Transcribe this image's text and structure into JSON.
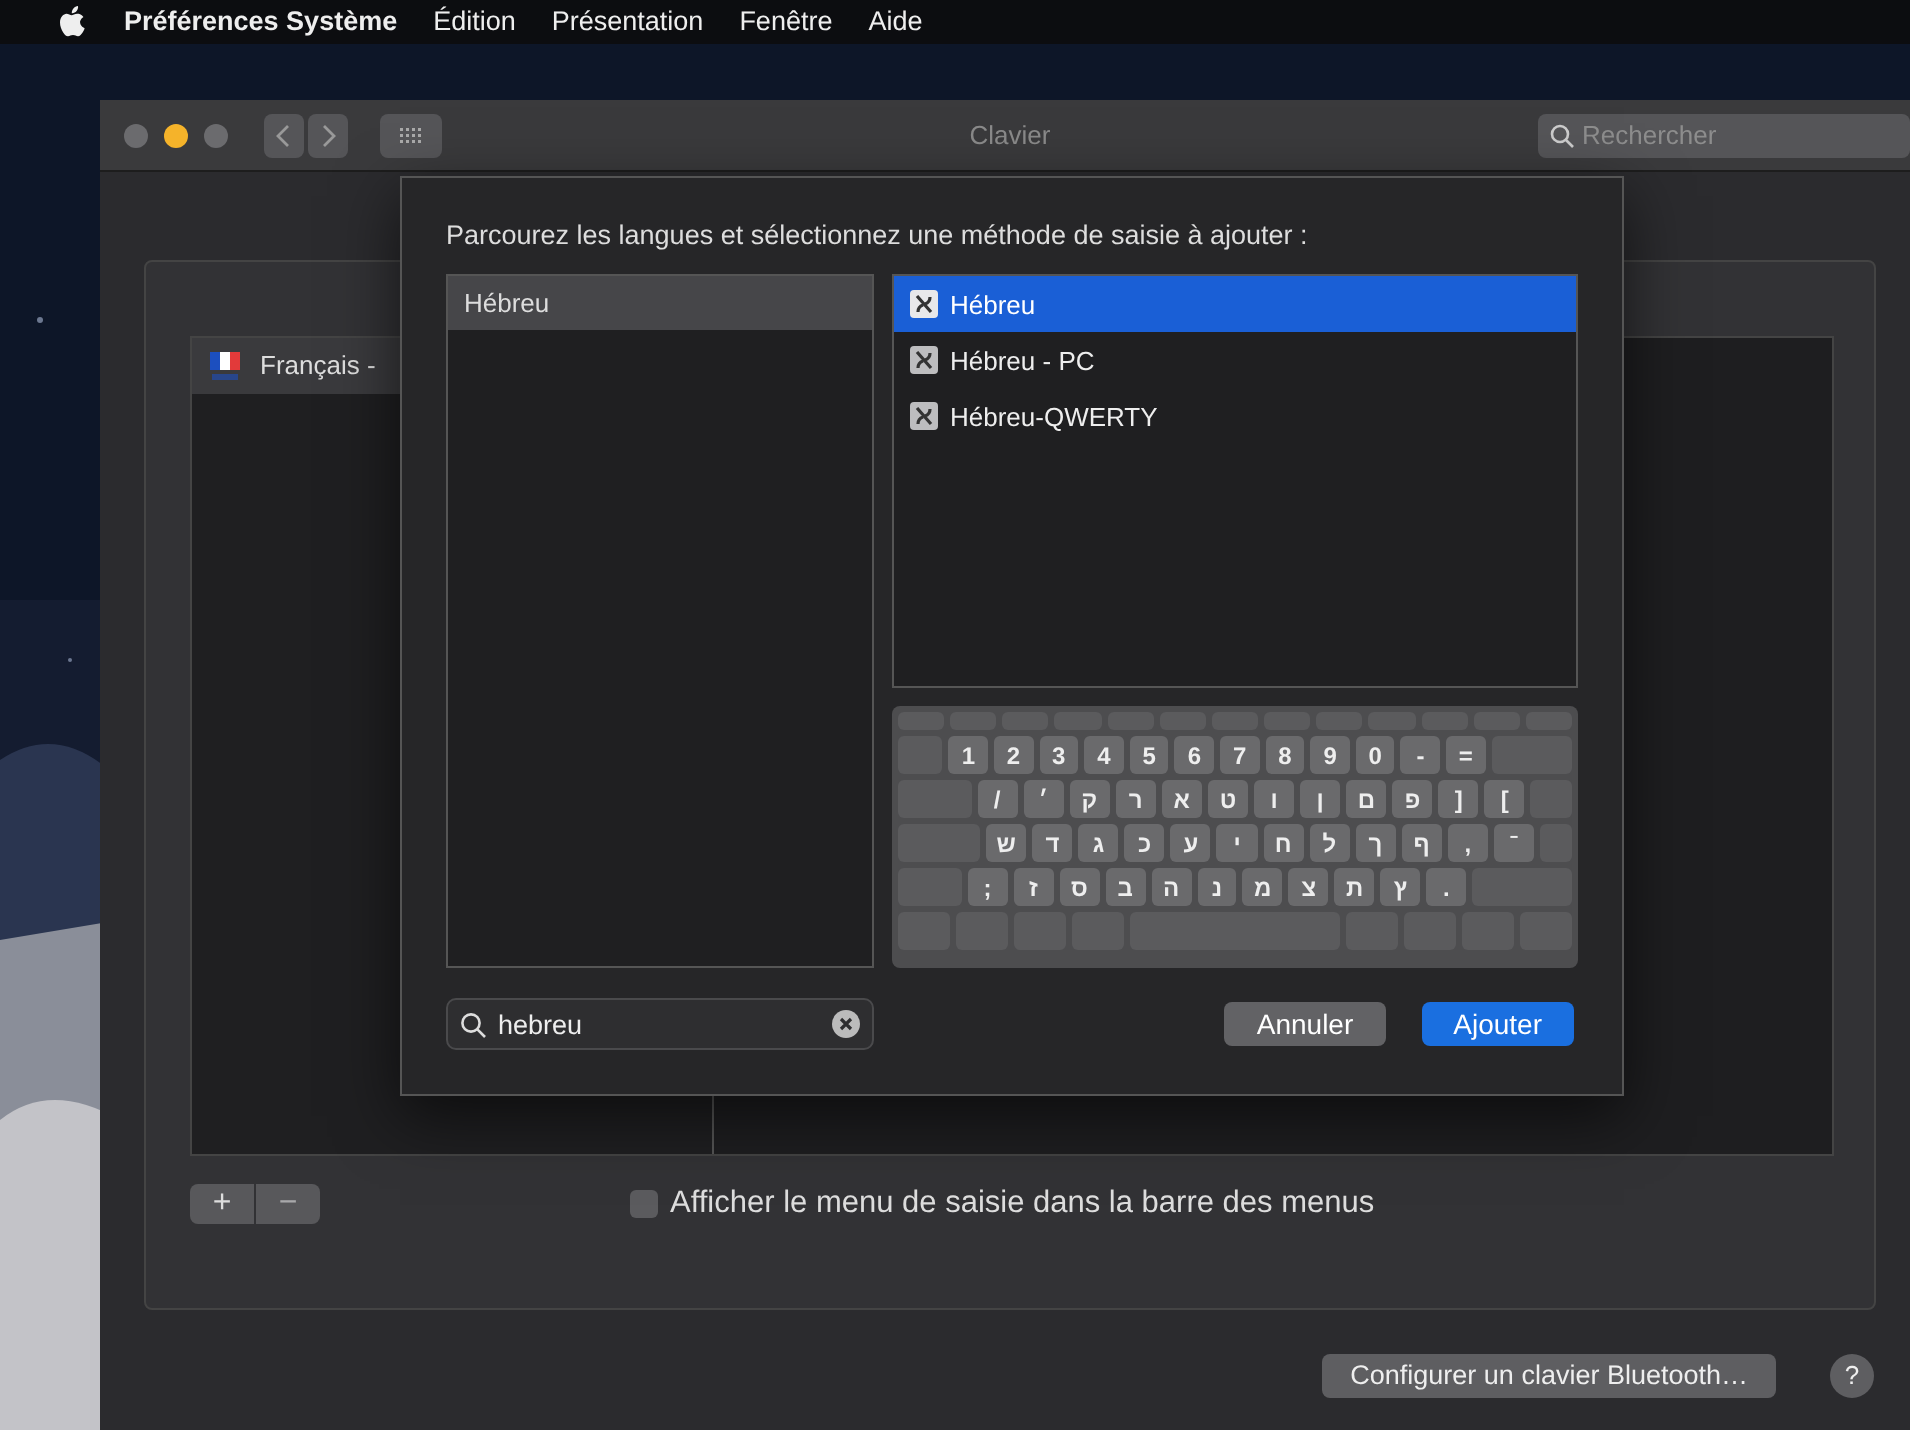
{
  "menu_bar": {
    "app": "Préférences Système",
    "items": [
      "Édition",
      "Présentation",
      "Fenêtre",
      "Aide"
    ]
  },
  "window": {
    "title": "Clavier",
    "search": {
      "placeholder": "Rechercher"
    }
  },
  "input_sources": {
    "items": [
      {
        "label": "Français -",
        "selected": false
      }
    ]
  },
  "show_input_menu": {
    "label": "Afficher le menu de saisie dans la barre des menus",
    "checked": false
  },
  "bluetooth_button": "Configurer un clavier Bluetooth…",
  "help_button": "?",
  "add_button": "+",
  "remove_button": "−",
  "sheet": {
    "prompt": "Parcourez les langues et sélectionnez une méthode de saisie à ajouter :",
    "languages": [
      {
        "label": "Hébreu",
        "selected": true
      }
    ],
    "methods": [
      {
        "label": "Hébreu",
        "selected": true
      },
      {
        "label": "Hébreu - PC",
        "selected": false
      },
      {
        "label": "Hébreu-QWERTY",
        "selected": false
      }
    ],
    "keyboard": [
      {
        "kind": "ltr",
        "keys": [
          "1",
          "2",
          "3",
          "4",
          "5",
          "6",
          "7",
          "8",
          "9",
          "0",
          "-",
          "="
        ]
      },
      {
        "kind": "rtl",
        "keys": [
          "[",
          "]",
          "פ",
          "ם",
          "ן",
          "ו",
          "ט",
          "א",
          "ר",
          "ק",
          "׳",
          "/"
        ]
      },
      {
        "kind": "rtl",
        "keys": [
          "ˉ",
          ",",
          "ף",
          "ך",
          "ל",
          "ח",
          "י",
          "ע",
          "כ",
          "ג",
          "ד",
          "ש"
        ]
      },
      {
        "kind": "rtl",
        "keys": [
          ".",
          "ץ",
          "ת",
          "צ",
          "מ",
          "נ",
          "ה",
          "ב",
          "ס",
          "ז",
          ";"
        ]
      }
    ],
    "search": {
      "value": "hebreu"
    },
    "buttons": [
      {
        "label": "Annuler",
        "kind": "cancel"
      },
      {
        "label": "Ajouter",
        "kind": "default"
      }
    ]
  }
}
